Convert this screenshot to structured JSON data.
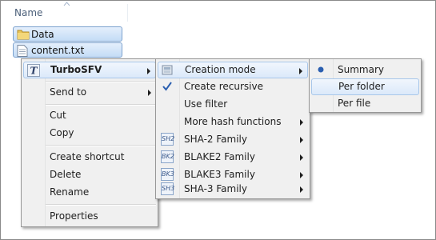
{
  "header": {
    "column_name": "Name"
  },
  "files": [
    {
      "name": "Data",
      "icon": "folder-icon"
    },
    {
      "name": "content.txt",
      "icon": "text-file-icon"
    }
  ],
  "context_menu": {
    "turbosfv": "TurboSFV",
    "send_to": "Send to",
    "cut": "Cut",
    "copy": "Copy",
    "create_shortcut": "Create shortcut",
    "delete": "Delete",
    "rename": "Rename",
    "properties": "Properties"
  },
  "turbosfv_submenu": {
    "creation_mode": "Creation mode",
    "create_recursive": "Create recursive",
    "use_filter": "Use filter",
    "more_hash_functions": "More hash functions",
    "sha2_family": "SHA-2 Family",
    "blake2_family": "BLAKE2 Family",
    "blake3_family": "BLAKE3 Family",
    "sha3_family": "SHA-3 Family",
    "badges": {
      "sha2": "SH2",
      "blake2": "BK2",
      "blake3": "BK3",
      "sha3": "SH3"
    }
  },
  "creation_mode_submenu": {
    "summary": "Summary",
    "per_folder": "Per folder",
    "per_file": "Per file",
    "selected": "Summary"
  },
  "colors": {
    "highlight": "#dbe9fa",
    "accent": "#3a6fc4",
    "check": "#2b5fb0"
  }
}
